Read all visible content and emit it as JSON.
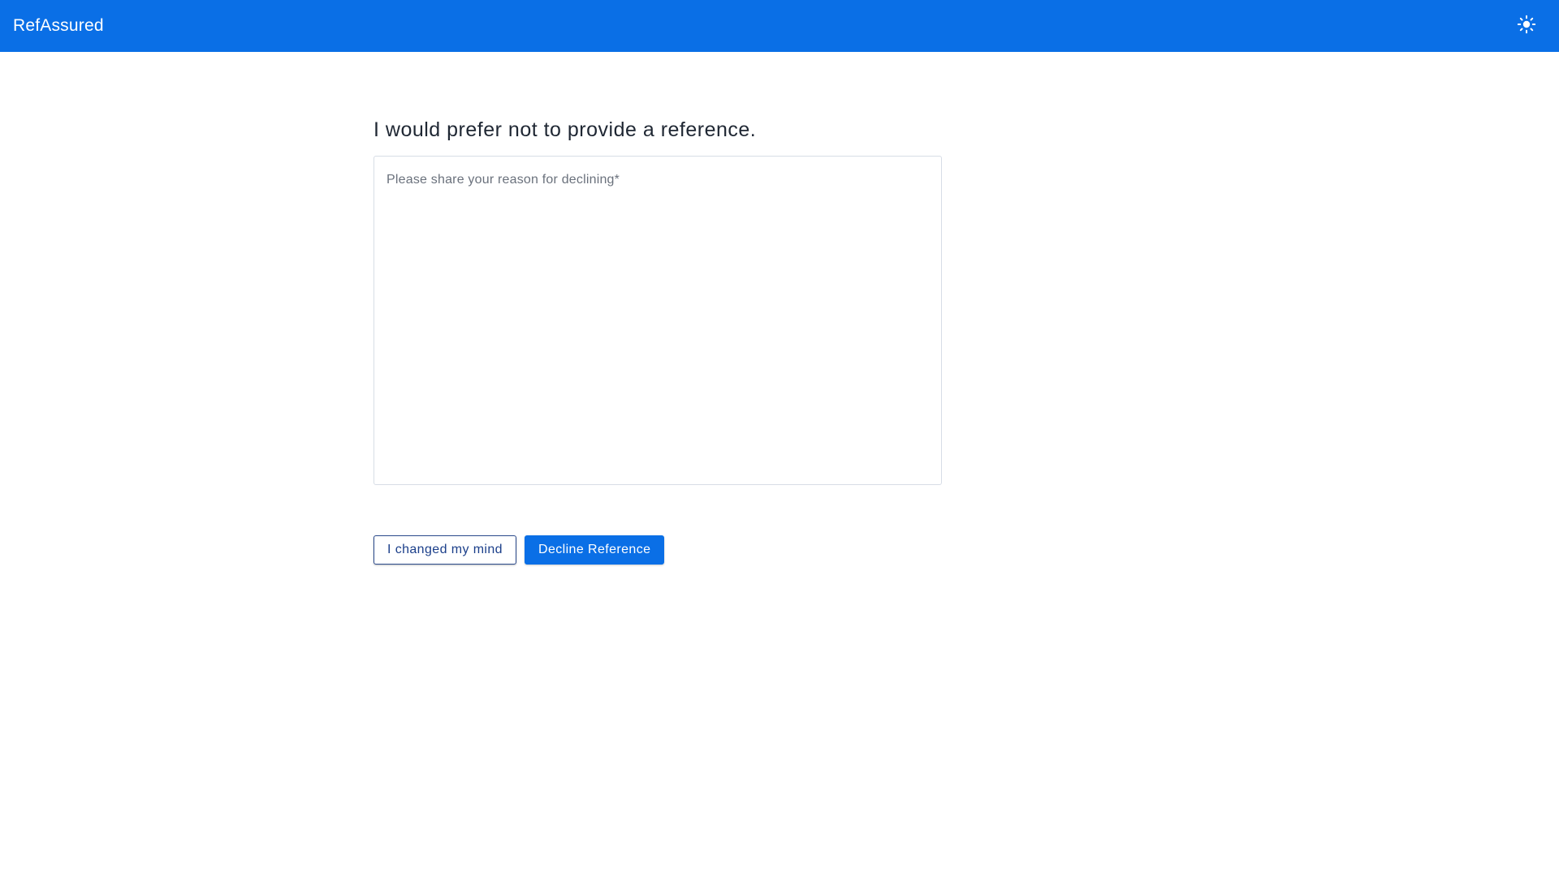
{
  "header": {
    "brand": "RefAssured",
    "theme_icon": "sun-icon"
  },
  "main": {
    "title": "I would prefer not to provide a reference.",
    "reason_field": {
      "placeholder": "Please share your reason for declining*",
      "value": ""
    },
    "buttons": {
      "changed_mind_label": "I changed my mind",
      "decline_label": "Decline Reference"
    }
  },
  "colors": {
    "brand": "#0a6fe6",
    "heading": "#1f2733",
    "secondary_button_border": "#2b4a8c"
  }
}
